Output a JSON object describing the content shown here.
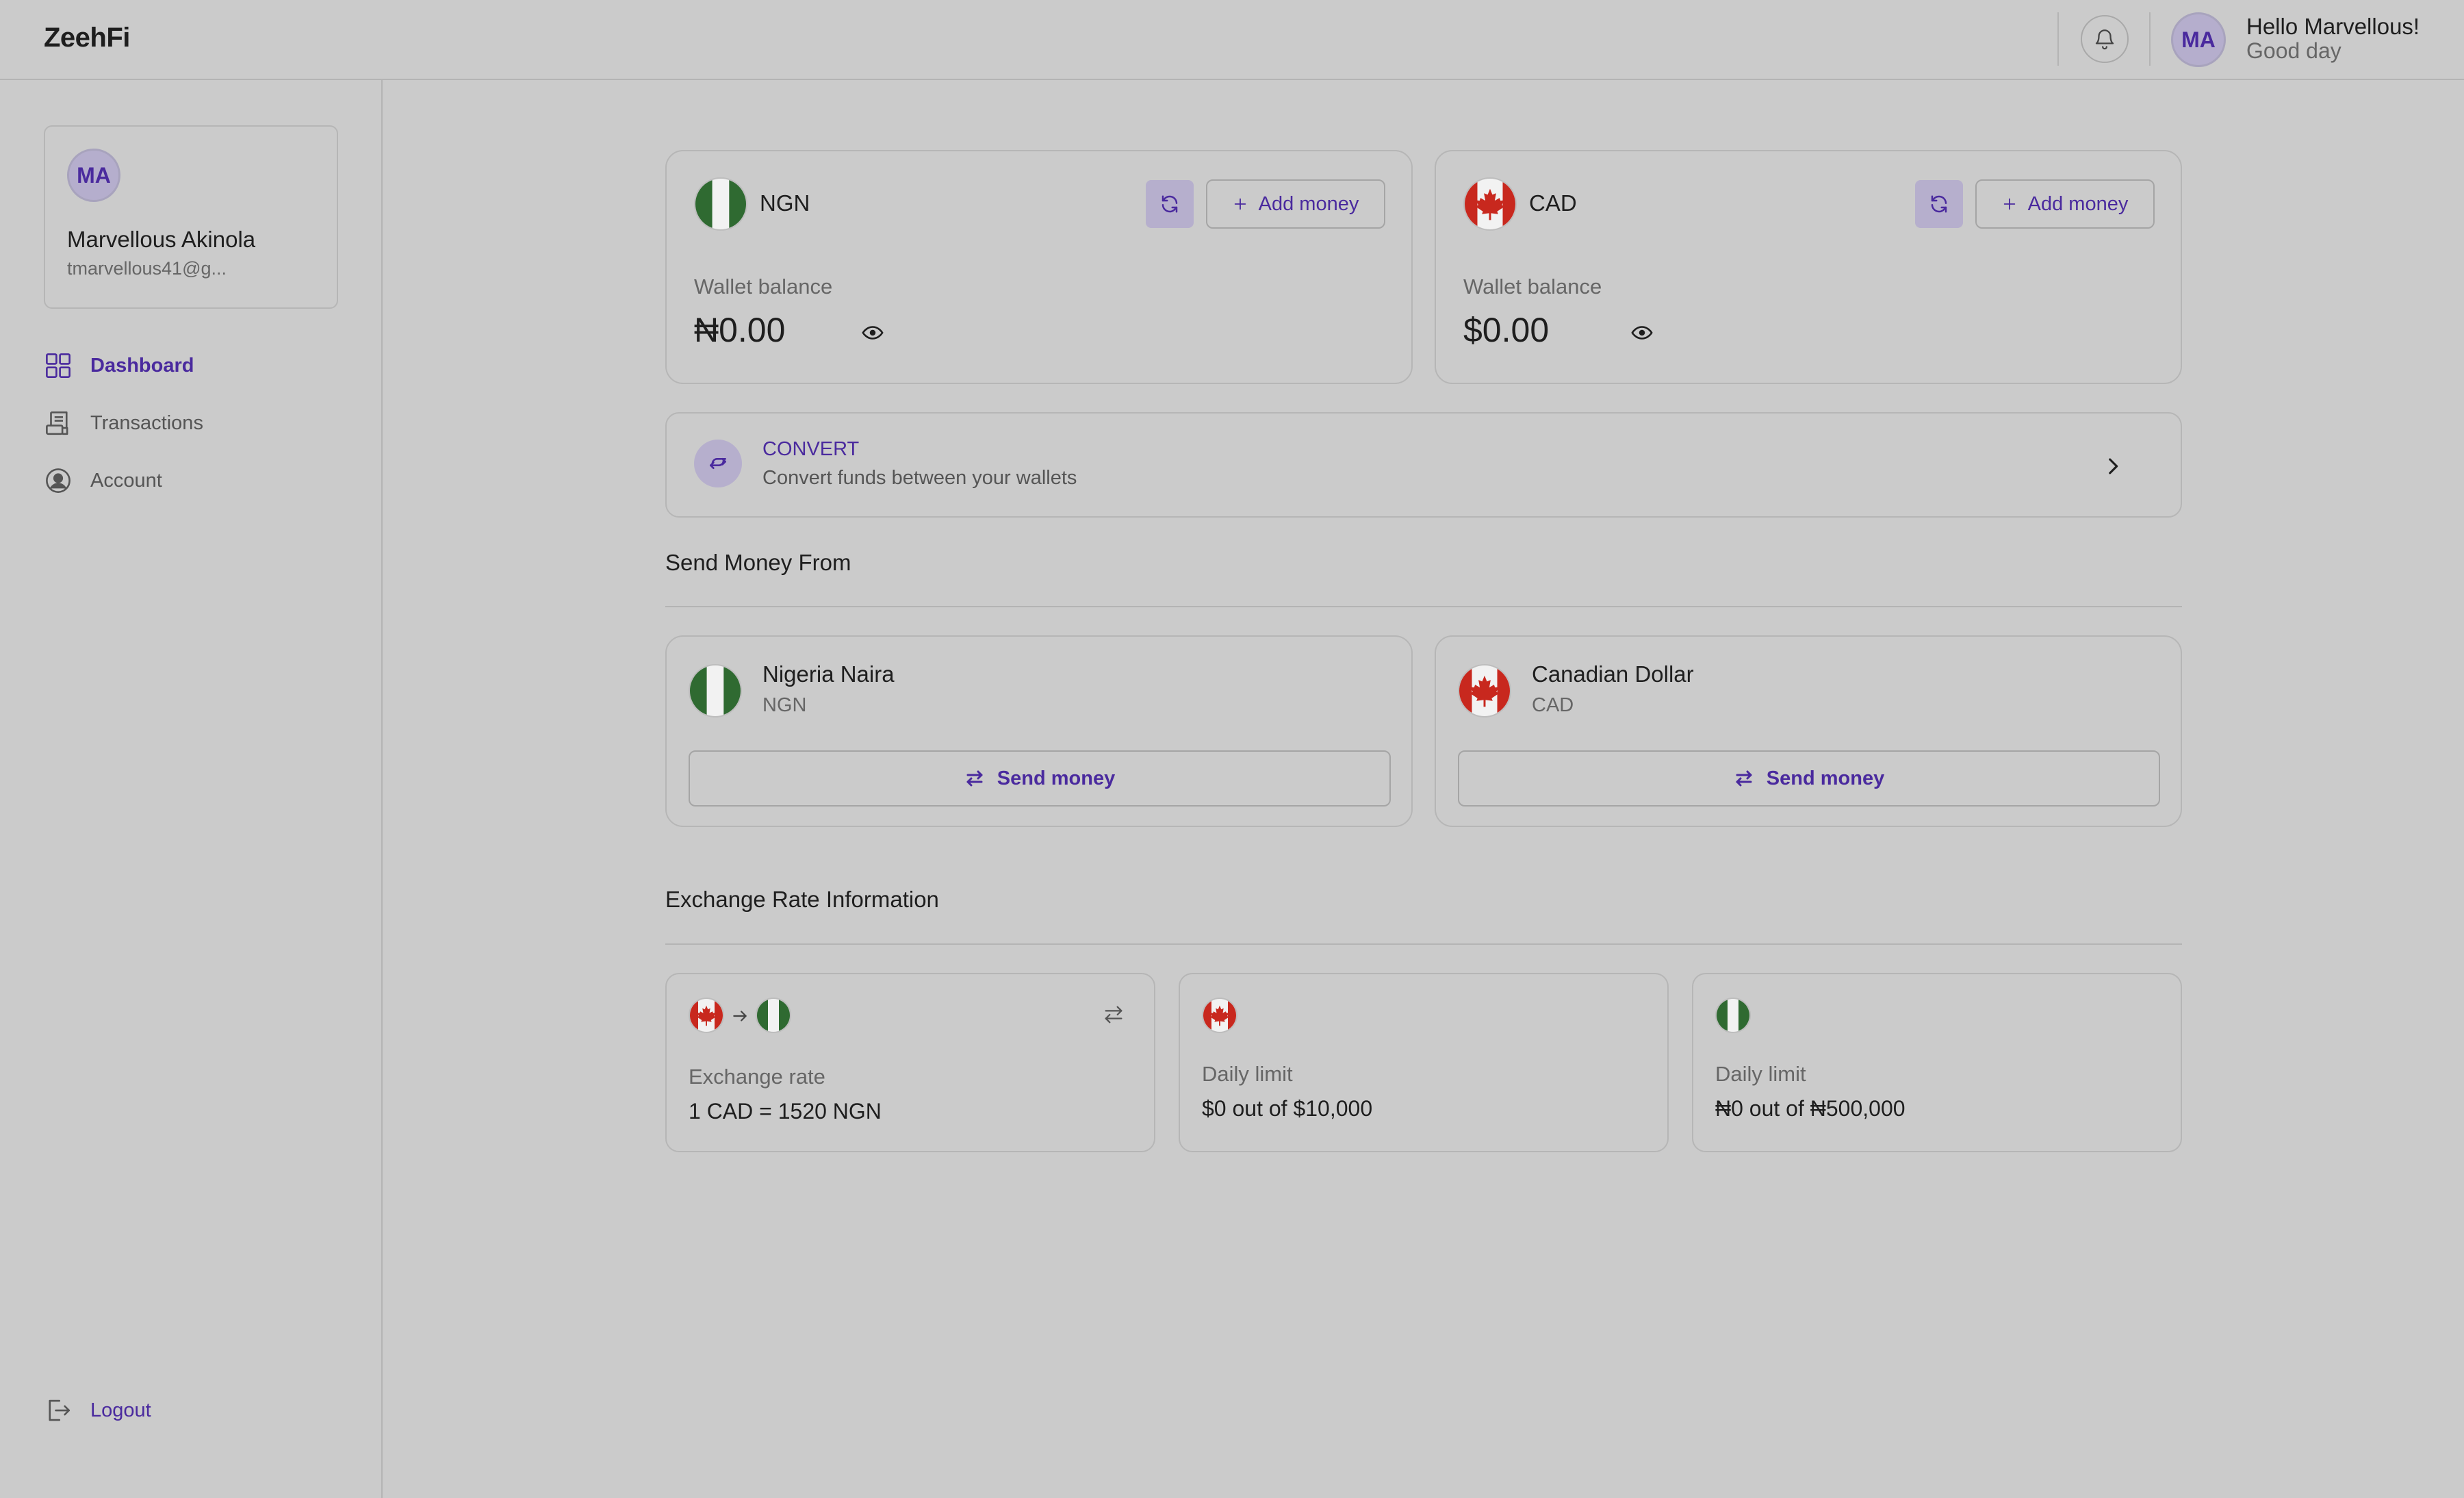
{
  "app": {
    "name": "ZeehFi"
  },
  "header": {
    "avatar_initials": "MA",
    "greeting": "Hello Marvellous!",
    "subgreeting": "Good day"
  },
  "sidebar": {
    "profile": {
      "initials": "MA",
      "name": "Marvellous Akinola",
      "email": "tmarvellous41@g..."
    },
    "items": [
      {
        "label": "Dashboard",
        "icon": "dashboard-grid-icon",
        "active": true
      },
      {
        "label": "Transactions",
        "icon": "receipt-icon",
        "active": false
      },
      {
        "label": "Account",
        "icon": "user-circle-icon",
        "active": false
      }
    ],
    "logout_label": "Logout"
  },
  "wallets": [
    {
      "code": "NGN",
      "add_label": "Add money",
      "balance_label": "Wallet balance",
      "balance": "₦0.00",
      "flag": "nigeria-flag-icon"
    },
    {
      "code": "CAD",
      "add_label": "Add money",
      "balance_label": "Wallet balance",
      "balance": "$0.00",
      "flag": "canada-flag-icon"
    }
  ],
  "convert": {
    "title": "CONVERT",
    "subtitle": "Convert funds between your wallets"
  },
  "send_section": {
    "title": "Send Money From",
    "items": [
      {
        "name": "Nigeria Naira",
        "code": "NGN",
        "button": "Send money"
      },
      {
        "name": "Canadian Dollar",
        "code": "CAD",
        "button": "Send money"
      }
    ]
  },
  "exchange_section": {
    "title": "Exchange Rate Information",
    "rate": {
      "label": "Exchange rate",
      "value": "1 CAD = 1520 NGN"
    },
    "limits": [
      {
        "label": "Daily limit",
        "value": "$0 out of $10,000"
      },
      {
        "label": "Daily limit",
        "value": "₦0 out of ₦500,000"
      }
    ]
  },
  "colors": {
    "accent": "#4a2a9e",
    "background": "#cbcbcb",
    "nigeria_green": "#2f6a31",
    "canada_red": "#c8281e"
  }
}
